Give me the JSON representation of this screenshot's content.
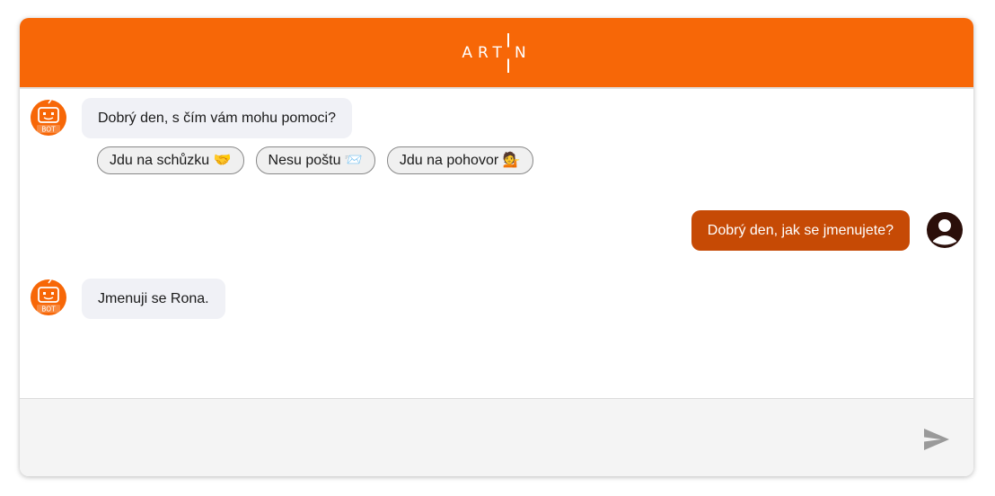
{
  "header": {
    "logo_left": "ART",
    "logo_right": "N",
    "brand_color": "#f76707"
  },
  "messages": [
    {
      "sender": "bot",
      "text": "Dobrý den, s čím vám mohu pomoci?"
    },
    {
      "sender": "user",
      "text": "Dobrý den, jak se jmenujete?"
    },
    {
      "sender": "bot",
      "text": "Jmenuji se Rona."
    }
  ],
  "bot_avatar": {
    "label": "BOT",
    "icon": "robot-icon"
  },
  "user_avatar": {
    "icon": "user-avatar-icon"
  },
  "quick_replies": [
    {
      "label": "Jdu na schůzku 🤝"
    },
    {
      "label": "Nesu poštu 📨"
    },
    {
      "label": "Jdu na pohovor 💁"
    }
  ],
  "input": {
    "placeholder": "",
    "value": ""
  },
  "send_icon": "send-icon",
  "colors": {
    "user_bubble": "#c64a05",
    "bot_bubble": "#f0f1f6",
    "input_bg": "#f4f4f4"
  }
}
